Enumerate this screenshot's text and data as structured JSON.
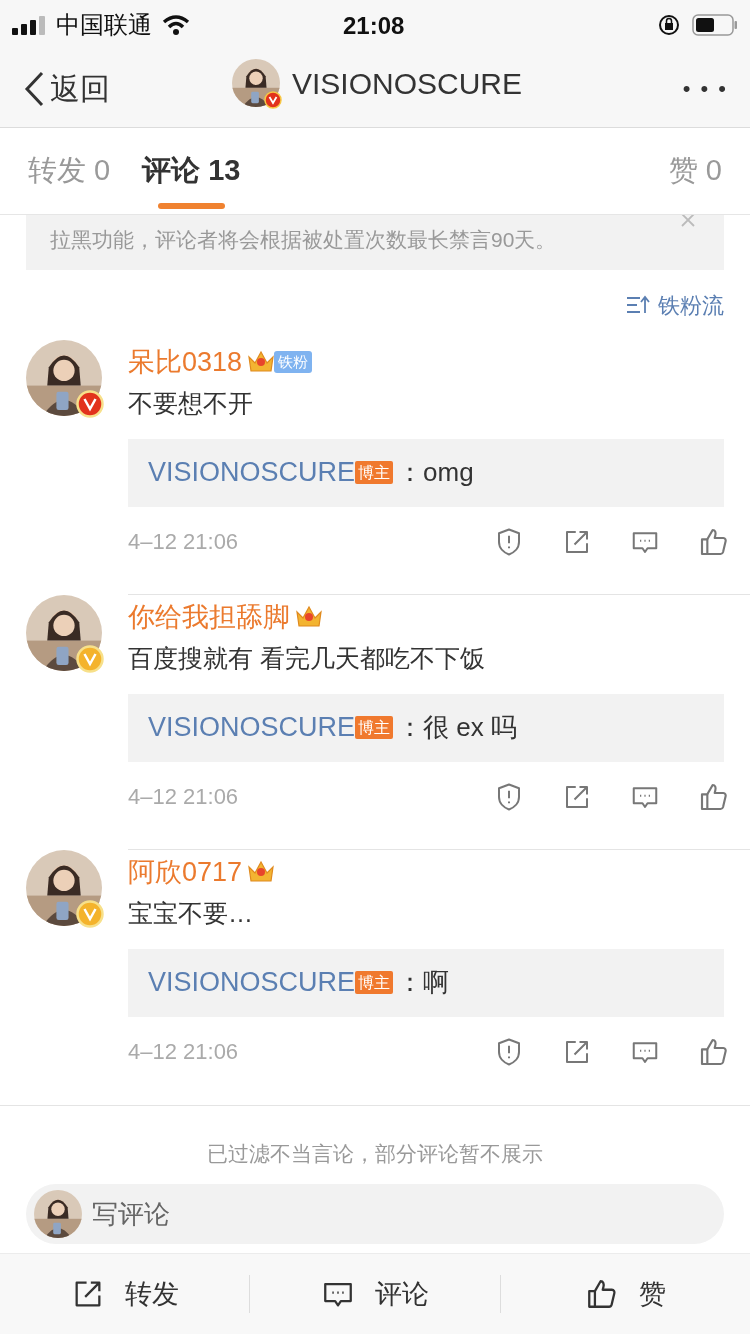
{
  "status_bar": {
    "carrier": "中国联通",
    "time": "21:08"
  },
  "header": {
    "back": "返回",
    "title": "VISIONOSCURE",
    "more": "• • •"
  },
  "tabs": [
    {
      "label": "转发 0",
      "selected": false
    },
    {
      "label": "评论 13",
      "selected": true
    },
    {
      "label": "赞 0",
      "selected": false
    }
  ],
  "notice": {
    "text": "拉黑功能，评论者将会根据被处置次数最长禁言90天。"
  },
  "sort": {
    "label": "铁粉流"
  },
  "comments": [
    {
      "name": "呆比0318",
      "badge": {
        "color": "#e2321c"
      },
      "fan_tag": "铁粉",
      "text": "不要想不开",
      "reply": {
        "author": "VISIONOSCURE",
        "role": "博主",
        "text": "：omg"
      },
      "time": "4–12 21:06"
    },
    {
      "name": "你给我担舔脚",
      "badge": {
        "color": "#f4b32c"
      },
      "text": "百度搜就有 看完几天都吃不下饭",
      "reply": {
        "author": "VISIONOSCURE",
        "role": "博主",
        "text": "：很 ex 吗"
      },
      "time": "4–12 21:06"
    },
    {
      "name": "阿欣0717",
      "badge": {
        "color": "#f4b32c"
      },
      "text": "宝宝不要…",
      "reply": {
        "author": "VISIONOSCURE",
        "role": "博主",
        "text": "：啊"
      },
      "time": "4–12 21:06"
    }
  ],
  "filter_note": "已过滤不当言论，部分评论暂不展示",
  "comment_input": {
    "placeholder": "写评论"
  },
  "actions": [
    {
      "kind": "repost",
      "label": "转发"
    },
    {
      "kind": "comment",
      "label": "评论"
    },
    {
      "kind": "like",
      "label": "赞"
    }
  ]
}
